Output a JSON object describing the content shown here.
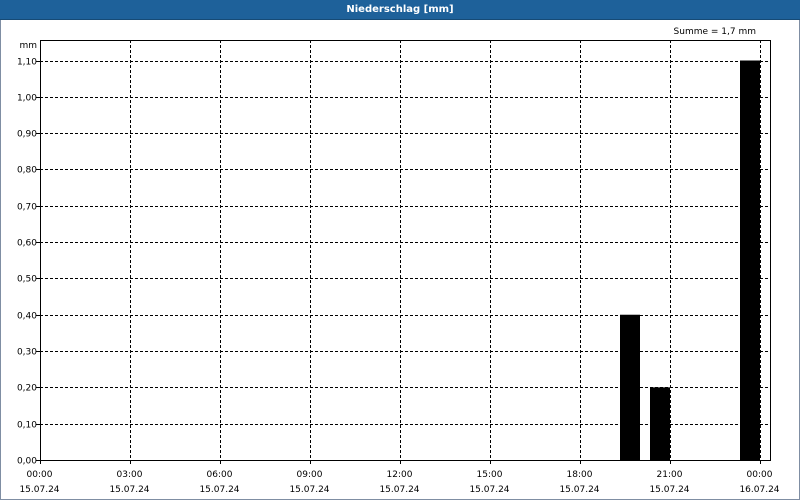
{
  "title": "Niederschlag [mm]",
  "sum_label": "Summe = 1,7 mm",
  "chart_data": {
    "type": "bar",
    "title": "Niederschlag [mm]",
    "ylabel": "mm",
    "xlabel": "",
    "ylim": [
      0,
      1.1
    ],
    "y_ticks": [
      "0,00",
      "0,10",
      "0,20",
      "0,30",
      "0,40",
      "0,50",
      "0,60",
      "0,70",
      "0,80",
      "0,90",
      "1,00",
      "1,10"
    ],
    "x_ticks": [
      {
        "time": "00:00",
        "date": "15.07.24"
      },
      {
        "time": "03:00",
        "date": "15.07.24"
      },
      {
        "time": "06:00",
        "date": "15.07.24"
      },
      {
        "time": "09:00",
        "date": "15.07.24"
      },
      {
        "time": "12:00",
        "date": "15.07.24"
      },
      {
        "time": "15:00",
        "date": "15.07.24"
      },
      {
        "time": "18:00",
        "date": "15.07.24"
      },
      {
        "time": "21:00",
        "date": "15.07.24"
      },
      {
        "time": "00:00",
        "date": "16.07.24"
      }
    ],
    "bars": [
      {
        "time": "19:40",
        "date": "15.07.24",
        "value": 0.4
      },
      {
        "time": "20:40",
        "date": "15.07.24",
        "value": 0.2
      },
      {
        "time": "23:40",
        "date": "15.07.24",
        "value": 1.1
      }
    ],
    "bar_color": "#000000",
    "grid": true,
    "summary": "Summe = 1,7 mm"
  }
}
